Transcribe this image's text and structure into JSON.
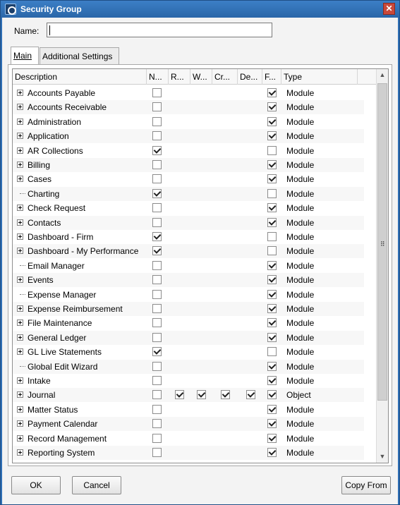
{
  "window": {
    "title": "Security Group",
    "close_glyph": "✕"
  },
  "form": {
    "name_label": "Name:",
    "name_value": ""
  },
  "tabs": [
    {
      "label": "Main",
      "active": true
    },
    {
      "label": "Additional Settings",
      "active": false
    }
  ],
  "grid": {
    "columns": [
      "Description",
      "N...",
      "R...",
      "W...",
      "Cr...",
      "De...",
      "F...",
      "Type"
    ],
    "rows": [
      {
        "description": "Accounts Payable",
        "expandable": true,
        "n": false,
        "f": true,
        "type": "Module"
      },
      {
        "description": "Accounts Receivable",
        "expandable": true,
        "n": false,
        "f": true,
        "type": "Module"
      },
      {
        "description": "Administration",
        "expandable": true,
        "n": false,
        "f": true,
        "type": "Module"
      },
      {
        "description": "Application",
        "expandable": true,
        "n": false,
        "f": true,
        "type": "Module"
      },
      {
        "description": "AR Collections",
        "expandable": true,
        "n": true,
        "f": false,
        "type": "Module"
      },
      {
        "description": "Billing",
        "expandable": true,
        "n": false,
        "f": true,
        "type": "Module"
      },
      {
        "description": "Cases",
        "expandable": true,
        "n": false,
        "f": true,
        "type": "Module"
      },
      {
        "description": "Charting",
        "expandable": false,
        "n": true,
        "f": false,
        "type": "Module"
      },
      {
        "description": "Check Request",
        "expandable": true,
        "n": false,
        "f": true,
        "type": "Module"
      },
      {
        "description": "Contacts",
        "expandable": true,
        "n": false,
        "f": true,
        "type": "Module"
      },
      {
        "description": "Dashboard - Firm",
        "expandable": true,
        "n": true,
        "f": false,
        "type": "Module"
      },
      {
        "description": "Dashboard - My Performance",
        "expandable": true,
        "n": true,
        "f": false,
        "type": "Module"
      },
      {
        "description": "Email Manager",
        "expandable": false,
        "n": false,
        "f": true,
        "type": "Module"
      },
      {
        "description": "Events",
        "expandable": true,
        "n": false,
        "f": true,
        "type": "Module"
      },
      {
        "description": "Expense Manager",
        "expandable": false,
        "n": false,
        "f": true,
        "type": "Module"
      },
      {
        "description": "Expense Reimbursement",
        "expandable": true,
        "n": false,
        "f": true,
        "type": "Module"
      },
      {
        "description": "File Maintenance",
        "expandable": true,
        "n": false,
        "f": true,
        "type": "Module"
      },
      {
        "description": "General Ledger",
        "expandable": true,
        "n": false,
        "f": true,
        "type": "Module"
      },
      {
        "description": "GL Live Statements",
        "expandable": true,
        "n": true,
        "f": false,
        "type": "Module"
      },
      {
        "description": "Global Edit Wizard",
        "expandable": false,
        "n": false,
        "f": true,
        "type": "Module"
      },
      {
        "description": "Intake",
        "expandable": true,
        "n": false,
        "f": true,
        "type": "Module"
      },
      {
        "description": "Journal",
        "expandable": true,
        "n": false,
        "r": true,
        "w": true,
        "cr": true,
        "de": true,
        "f": true,
        "type": "Object"
      },
      {
        "description": "Matter Status",
        "expandable": true,
        "n": false,
        "f": true,
        "type": "Module"
      },
      {
        "description": "Payment Calendar",
        "expandable": true,
        "n": false,
        "f": true,
        "type": "Module"
      },
      {
        "description": "Record Management",
        "expandable": true,
        "n": false,
        "f": true,
        "type": "Module"
      },
      {
        "description": "Reporting System",
        "expandable": true,
        "n": false,
        "f": true,
        "type": "Module"
      }
    ]
  },
  "scrollbar": {
    "up_glyph": "▲",
    "down_glyph": "▼",
    "grip_glyph": "⠿"
  },
  "buttons": {
    "ok": "OK",
    "cancel": "Cancel",
    "copy_from": "Copy From"
  },
  "icons": {
    "app": "app-icon",
    "close": "close-icon",
    "expander": "plus-box-icon"
  }
}
